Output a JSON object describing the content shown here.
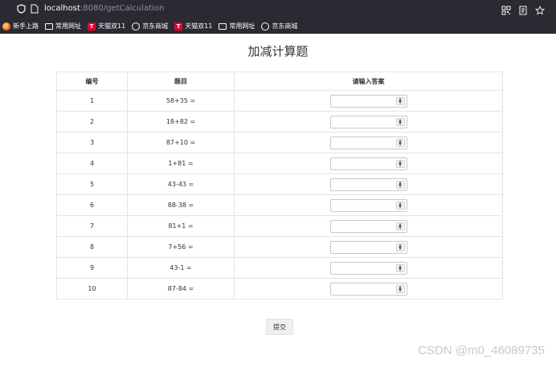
{
  "browser": {
    "url_host": "localhost",
    "url_rest": ":8080/getCalculation",
    "bookmarks": [
      {
        "icon": "firefox-icon",
        "label": "新手上路"
      },
      {
        "icon": "folder-icon",
        "label": "常用网址"
      },
      {
        "icon": "tmall-icon",
        "label": "天猫双11"
      },
      {
        "icon": "globe-icon",
        "label": "京东商城"
      },
      {
        "icon": "tmall-icon",
        "label": "天猫双11"
      },
      {
        "icon": "folder-icon",
        "label": "常用网址"
      },
      {
        "icon": "globe-icon",
        "label": "京东商城"
      }
    ]
  },
  "page": {
    "title": "加减计算题",
    "headers": {
      "no": "编号",
      "question": "题目",
      "answer": "请输入答案"
    },
    "rows": [
      {
        "no": "1",
        "question": "58+35 ="
      },
      {
        "no": "2",
        "question": "18+82 ="
      },
      {
        "no": "3",
        "question": "87+10 ="
      },
      {
        "no": "4",
        "question": "1+81 ="
      },
      {
        "no": "5",
        "question": "43-43 ="
      },
      {
        "no": "6",
        "question": "88-38 ="
      },
      {
        "no": "7",
        "question": "81+1 ="
      },
      {
        "no": "8",
        "question": "7+56 ="
      },
      {
        "no": "9",
        "question": "43-1 ="
      },
      {
        "no": "10",
        "question": "87-84 ="
      }
    ],
    "submit_label": "提交"
  },
  "watermark": "CSDN @m0_46089735"
}
